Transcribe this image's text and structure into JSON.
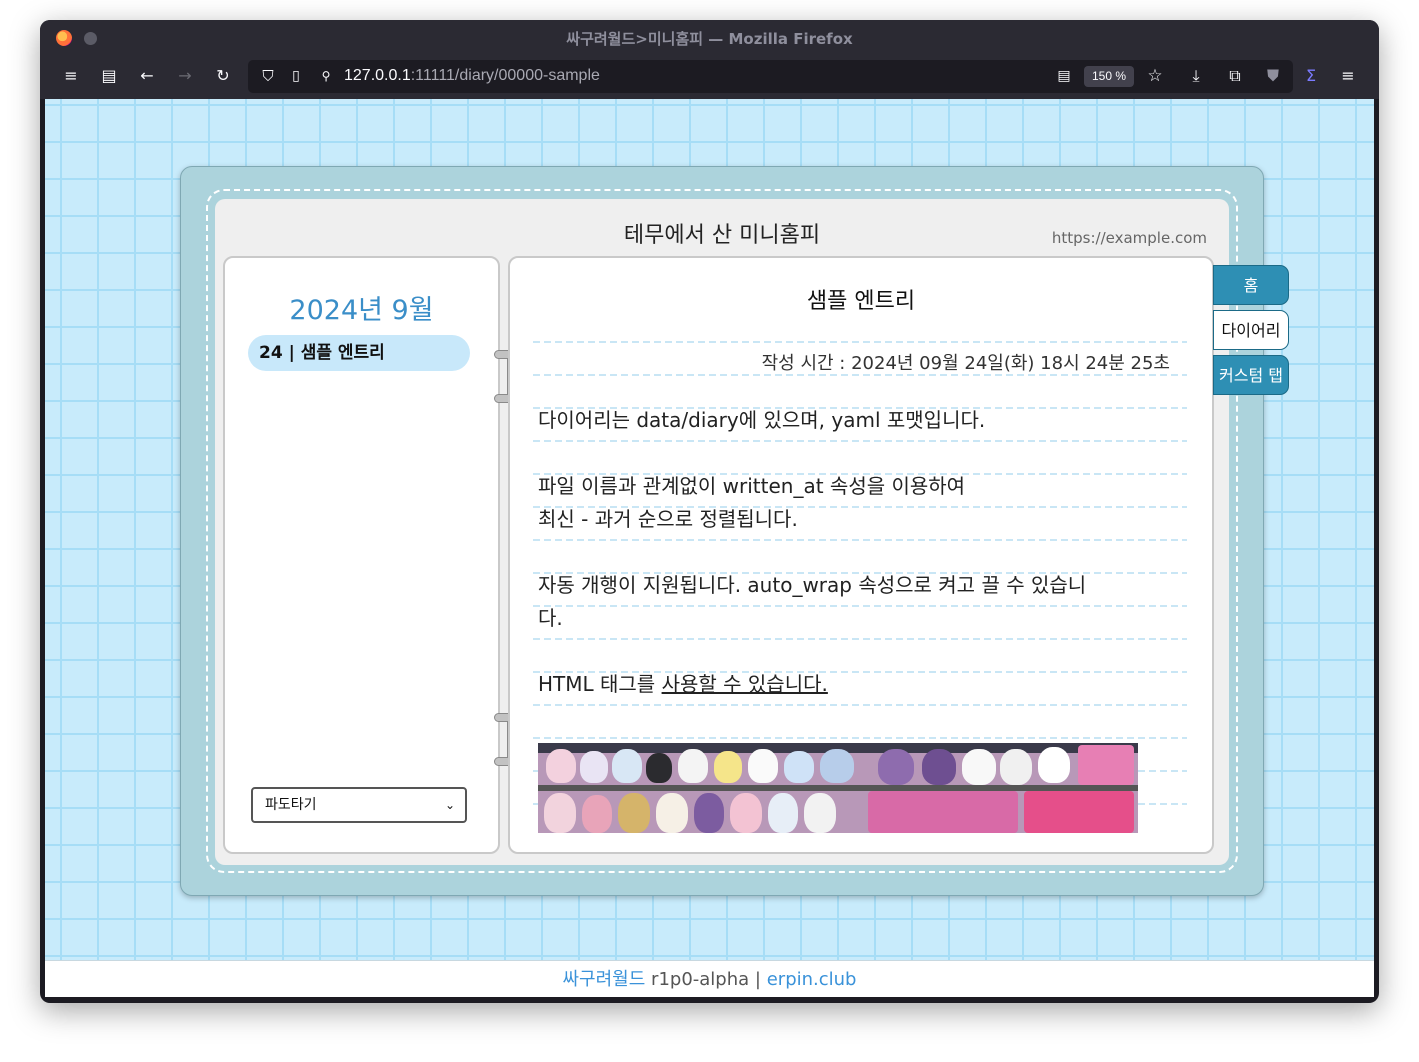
{
  "browser": {
    "window_title": "싸구려월드>미니홈피 — Mozilla Firefox",
    "url_host": "127.0.0.1",
    "url_rest": ":11111/diary/00000-sample",
    "zoom": "150 %"
  },
  "book": {
    "title": "테무에서 산 미니홈피",
    "url": "https://example.com"
  },
  "left_page": {
    "month": "2024년 9월",
    "entries": [
      {
        "label": "24 | 샘플 엔트리"
      }
    ],
    "jump_select": {
      "value": "파도타기"
    }
  },
  "entry": {
    "title": "샘플 엔트리",
    "meta": "작성 시간 : 2024년 09월 24일(화) 18시 24분 25초",
    "p1": "다이어리는 data/diary에 있으며, yaml 포맷입니다.",
    "p2a": "파일 이름과 관계없이 written_at 속성을 이용하여",
    "p2b": "최신 - 과거 순으로 정렬됩니다.",
    "p3a": "자동 개행이 지원됩니다. auto_wrap 속성으로 켜고 끌 수 있습니",
    "p3b": "다.",
    "p4a": "HTML 태그를",
    "p4b": "사용할 수 있습니다."
  },
  "tabs": [
    {
      "label": "홈",
      "state": "active"
    },
    {
      "label": "다이어리",
      "state": "current"
    },
    {
      "label": "커스텀 탭",
      "state": "active"
    }
  ],
  "footer": {
    "brand": "싸구려월드",
    "version": "r1p0-alpha",
    "sep": "|",
    "link": "erpin.club"
  },
  "colors": {
    "background_grid": "#c8ebfb",
    "book_frame": "#acd3dc",
    "accent_blue": "#3a8ec8",
    "tab_blue": "#2e8fb4",
    "selected_entry": "#c8e8fa"
  }
}
